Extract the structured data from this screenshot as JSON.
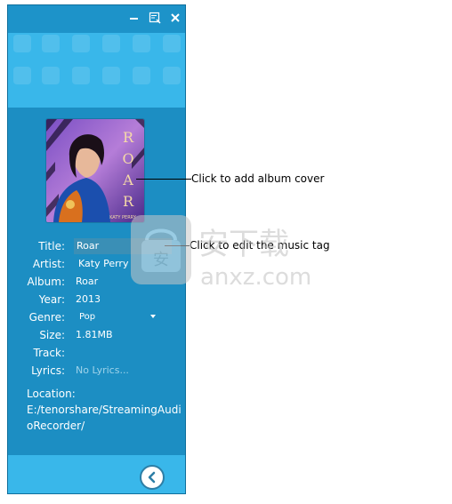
{
  "window": {
    "controls": {
      "minimize_icon": "minimize-icon",
      "edit_icon": "edit-tag-icon",
      "close_icon": "close-icon"
    }
  },
  "album_cover": {
    "caption_left": "ROAR",
    "artist_text": "KATY PERRY"
  },
  "tags": {
    "title_label": "Title:",
    "title_value": "Roar",
    "artist_label": "Artist:",
    "artist_value": "Katy Perry",
    "album_label": "Album:",
    "album_value": "Roar",
    "year_label": "Year:",
    "year_value": "2013",
    "genre_label": "Genre:",
    "genre_value": "Pop",
    "size_label": "Size:",
    "size_value": "1.81MB",
    "track_label": "Track:",
    "track_value": "",
    "lyrics_label": "Lyrics:",
    "lyrics_value": "No Lyrics..."
  },
  "location": {
    "label": "Location:",
    "value": "E:/tenorshare/StreamingAudioRecorder/"
  },
  "footer": {
    "back_icon": "back-arrow-icon"
  },
  "callouts": {
    "cover": "Click to add album cover",
    "tag": "Click to edit the music tag"
  },
  "watermark": {
    "text_cn": "安下载",
    "text_en": "anxz.com"
  },
  "colors": {
    "panel": "#1c8ec3",
    "header": "#39b7ea",
    "accent": "#2d7ea6"
  }
}
